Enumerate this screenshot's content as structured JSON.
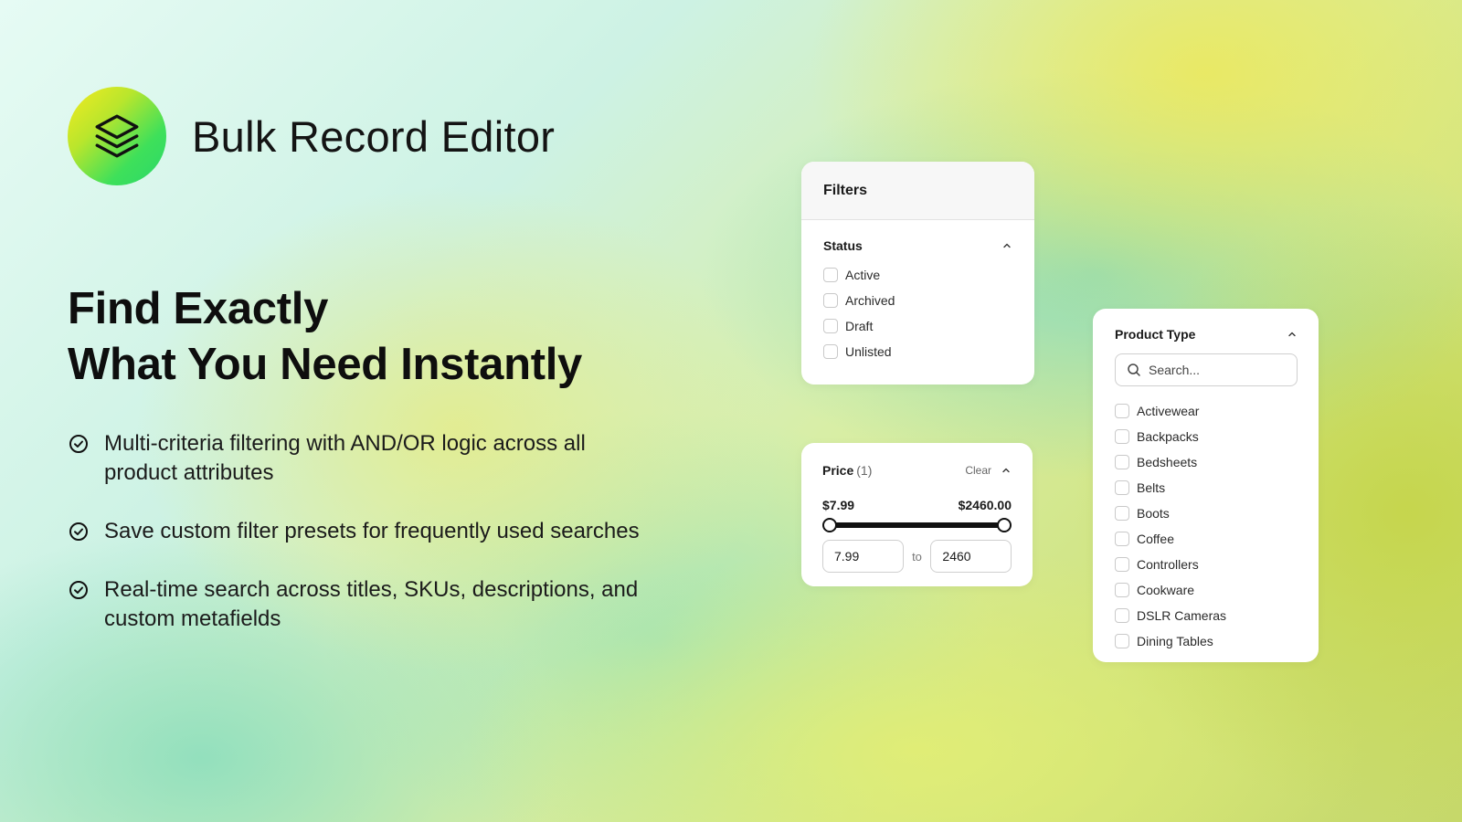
{
  "brand": {
    "name": "Bulk Record Editor",
    "logo_icon": "layers-icon"
  },
  "headline": {
    "line1": "Find Exactly",
    "line2": "What You Need Instantly"
  },
  "features": [
    {
      "text": "Multi-criteria filtering with AND/OR logic across all product attributes",
      "icon": "check-circle-icon"
    },
    {
      "text": "Save custom filter presets for frequently used searches",
      "icon": "check-circle-icon"
    },
    {
      "text": "Real-time search across titles, SKUs, descriptions, and custom metafields",
      "icon": "check-circle-icon"
    }
  ],
  "filters_card": {
    "title": "Filters",
    "status": {
      "title": "Status",
      "options": [
        "Active",
        "Archived",
        "Draft",
        "Unlisted"
      ]
    }
  },
  "price_card": {
    "title": "Price",
    "count": "(1)",
    "clear_label": "Clear",
    "min_display": "$7.99",
    "max_display": "$2460.00",
    "min_value": "7.99",
    "to_label": "to",
    "max_value": "2460"
  },
  "product_type_card": {
    "title": "Product Type",
    "search_placeholder": "Search...",
    "options": [
      "Activewear",
      "Backpacks",
      "Bedsheets",
      "Belts",
      "Boots",
      "Coffee",
      "Controllers",
      "Cookware",
      "DSLR Cameras",
      "Dining Tables"
    ]
  },
  "colors": {
    "accent": "#111111",
    "logo_gradient_start": "#f6ea20",
    "logo_gradient_end": "#2bd86a"
  }
}
